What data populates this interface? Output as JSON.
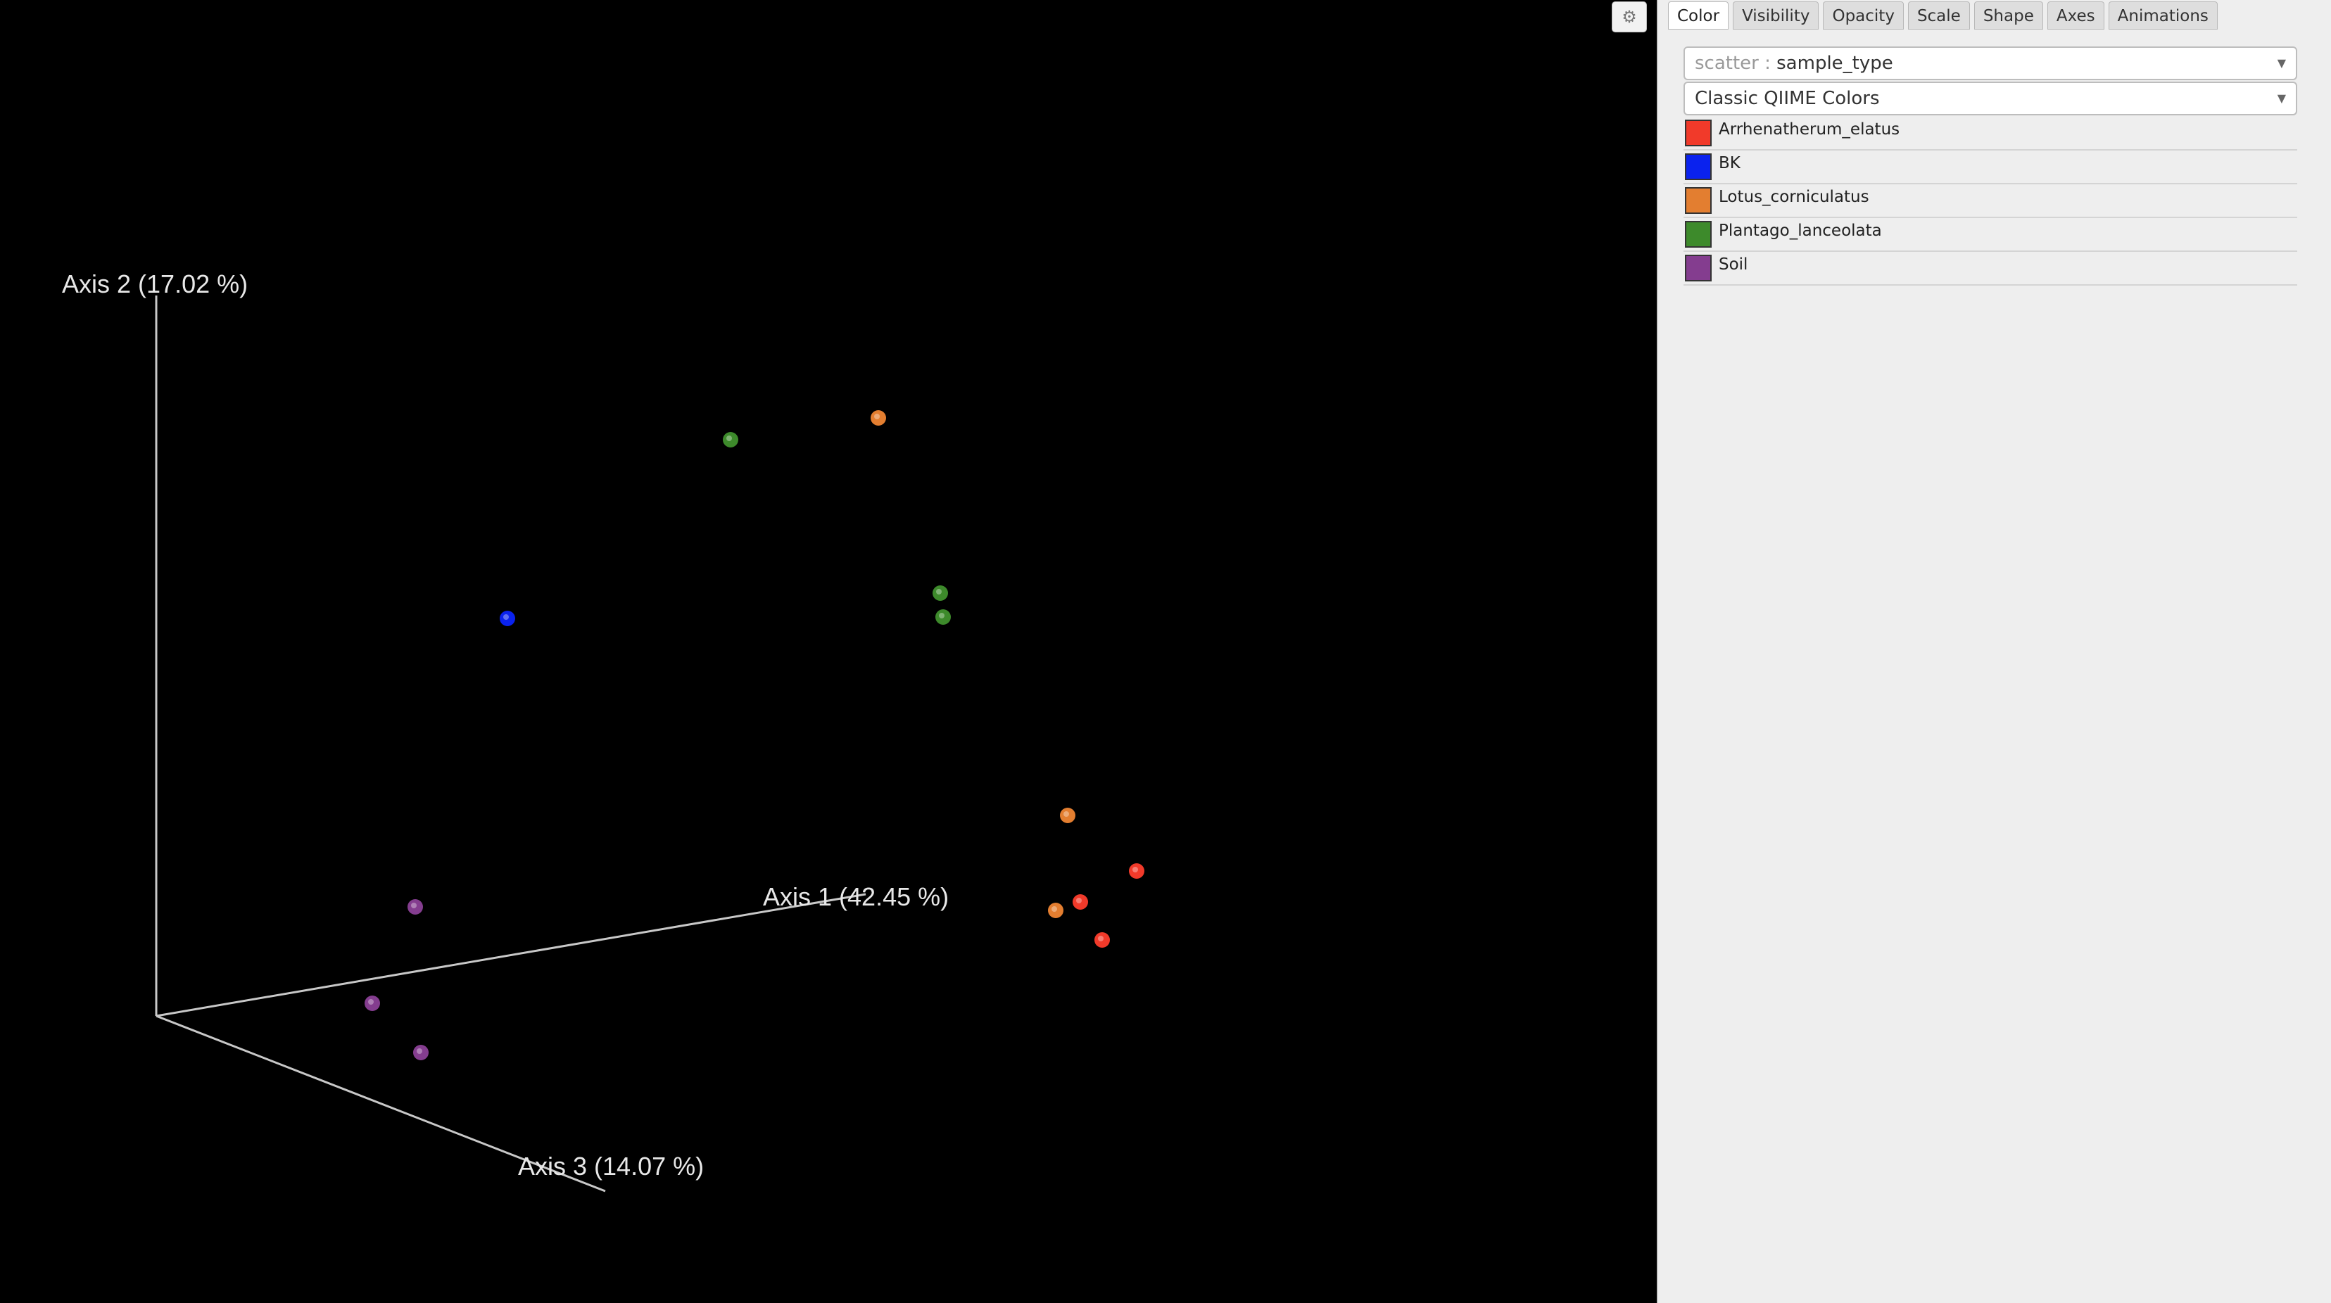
{
  "plot": {
    "axis_labels": {
      "axis1": "Axis 1 (42.45 %)",
      "axis2": "Axis 2 (17.02 %)",
      "axis3": "Axis 3 (14.07 %)"
    },
    "background": "#000000",
    "axis_color": "#c8c8c8"
  },
  "settings_icon": "gear-icon",
  "tabs": [
    {
      "label": "Color",
      "active": true
    },
    {
      "label": "Visibility",
      "active": false
    },
    {
      "label": "Opacity",
      "active": false
    },
    {
      "label": "Scale",
      "active": false
    },
    {
      "label": "Shape",
      "active": false
    },
    {
      "label": "Axes",
      "active": false
    },
    {
      "label": "Animations",
      "active": false
    }
  ],
  "color_category": {
    "prefix": "scatter :",
    "value": "sample_type"
  },
  "color_scheme": {
    "value": "Classic QIIME Colors"
  },
  "legend": [
    {
      "label": "Arrhenatherum_elatus",
      "color": "#f13a2a"
    },
    {
      "label": "BK",
      "color": "#0a22ee"
    },
    {
      "label": "Lotus_corniculatus",
      "color": "#e37e30"
    },
    {
      "label": "Plantago_lanceolata",
      "color": "#3d8a2b"
    },
    {
      "label": "Soil",
      "color": "#843d8f"
    }
  ],
  "chart_data": {
    "type": "scatter",
    "title": "",
    "series": [
      {
        "name": "Arrhenatherum_elatus",
        "color": "#f13a2a",
        "points": [
          [
            1615,
            1238
          ],
          [
            1535,
            1282
          ],
          [
            1566,
            1336
          ]
        ]
      },
      {
        "name": "BK",
        "color": "#0a22ee",
        "points": [
          [
            721,
            879
          ]
        ]
      },
      {
        "name": "Lotus_corniculatus",
        "color": "#e37e30",
        "points": [
          [
            1248,
            594
          ],
          [
            1517,
            1159
          ],
          [
            1500,
            1294
          ]
        ]
      },
      {
        "name": "Plantago_lanceolata",
        "color": "#3d8a2b",
        "points": [
          [
            1038,
            625
          ],
          [
            1336,
            843
          ],
          [
            1340,
            877
          ]
        ]
      },
      {
        "name": "Soil",
        "color": "#843d8f",
        "points": [
          [
            590,
            1289
          ],
          [
            529,
            1426
          ],
          [
            598,
            1496
          ]
        ]
      }
    ],
    "axes": [
      "Axis 1 (42.45 %)",
      "Axis 2 (17.02 %)",
      "Axis 3 (14.07 %)"
    ]
  }
}
